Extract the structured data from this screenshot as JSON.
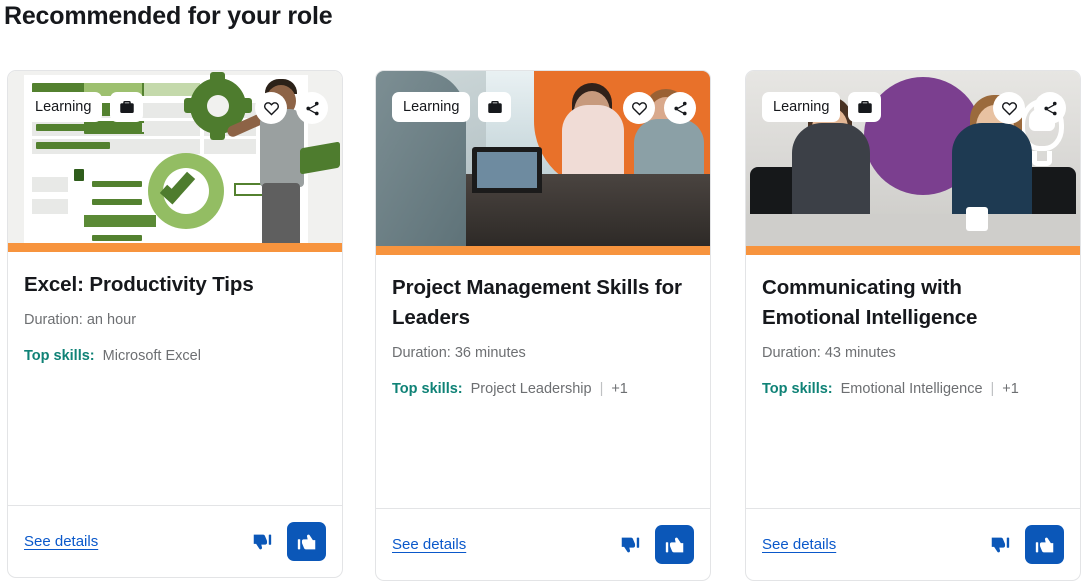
{
  "section": {
    "title": "Recommended for your role"
  },
  "labels": {
    "learning_badge": "Learning",
    "top_skills_label": "Top skills:",
    "see_details": "See details",
    "skills_separator": "|"
  },
  "icons": {
    "briefcase": "briefcase-icon",
    "heart": "heart-icon",
    "share": "share-icon",
    "thumb_up": "thumbs-up-icon",
    "thumb_down": "thumbs-down-icon"
  },
  "colors": {
    "accent_orange": "#f7943e",
    "link_blue": "#0a58ca",
    "button_blue": "#0b57b8",
    "skills_teal": "#0f8276",
    "text_primary": "#16181c",
    "text_muted": "#6d6f72",
    "card_border": "#e3e4e6",
    "purple_circle": "#7b3f8f"
  },
  "cards": [
    {
      "badge": "Learning",
      "title": "Excel: Productivity Tips",
      "duration": "Duration: an hour",
      "skills_label": "Top skills:",
      "skill": "Microsoft Excel",
      "more": "",
      "see_details": "See details"
    },
    {
      "badge": "Learning",
      "title": "Project Management Skills for Leaders",
      "duration": "Duration: 36 minutes",
      "skills_label": "Top skills:",
      "skill": "Project Leadership",
      "more": "+1",
      "see_details": "See details"
    },
    {
      "badge": "Learning",
      "title": "Communicating with Emotional Intelligence",
      "duration": "Duration: 43 minutes",
      "skills_label": "Top skills:",
      "skill": "Emotional Intelligence",
      "more": "+1",
      "see_details": "See details"
    }
  ]
}
